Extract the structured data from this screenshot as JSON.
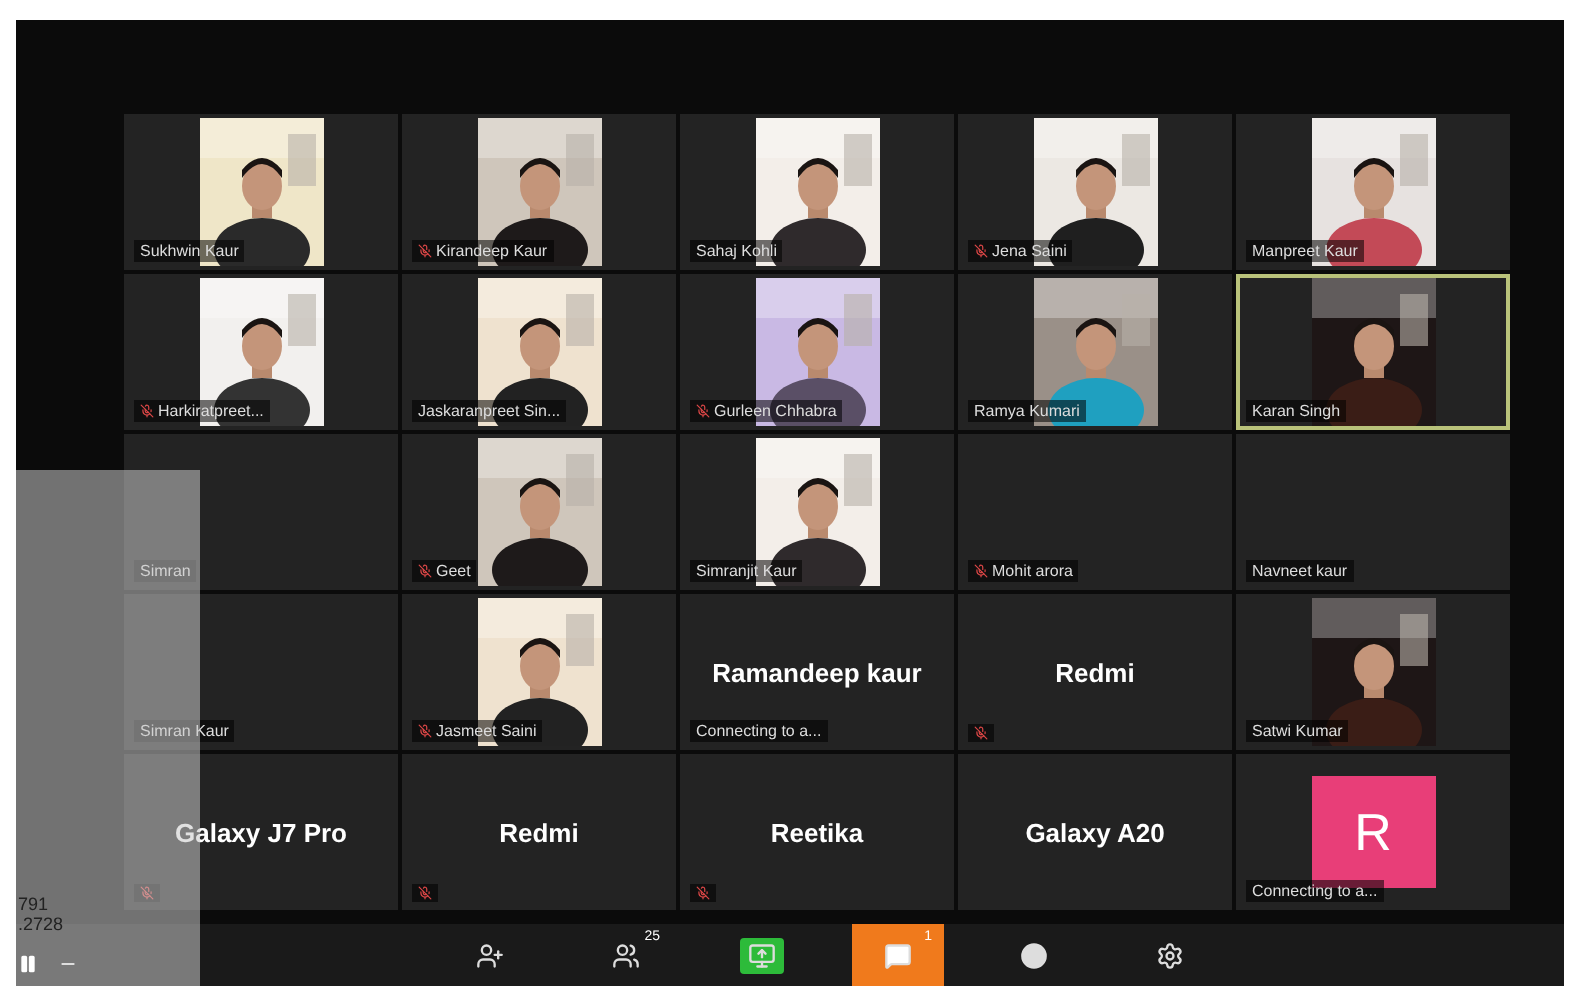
{
  "tiles": [
    {
      "kind": "video",
      "name": "Sukhwin Kaur",
      "muted": false,
      "selected": false
    },
    {
      "kind": "video",
      "name": "Kirandeep Kaur",
      "muted": true,
      "selected": false
    },
    {
      "kind": "video",
      "name": "Sahaj Kohli",
      "muted": false,
      "selected": false
    },
    {
      "kind": "video",
      "name": "Jena Saini",
      "muted": true,
      "selected": false
    },
    {
      "kind": "video",
      "name": "Manpreet Kaur",
      "muted": false,
      "selected": false
    },
    {
      "kind": "video",
      "name": "Harkiratpreet...",
      "muted": true,
      "selected": false
    },
    {
      "kind": "video",
      "name": "Jaskaranpreet Sin...",
      "muted": false,
      "selected": false
    },
    {
      "kind": "video",
      "name": "Gurleen Chhabra",
      "muted": true,
      "selected": false
    },
    {
      "kind": "video",
      "name": "Ramya Kumari",
      "muted": false,
      "selected": false
    },
    {
      "kind": "video",
      "name": "Karan Singh",
      "muted": false,
      "selected": true
    },
    {
      "kind": "empty",
      "name": "Simran",
      "muted": false,
      "selected": false
    },
    {
      "kind": "video",
      "name": "Geet",
      "muted": true,
      "selected": false
    },
    {
      "kind": "video",
      "name": "Simranjit Kaur",
      "muted": false,
      "selected": false
    },
    {
      "kind": "empty",
      "name": "Mohit arora",
      "muted": true,
      "selected": false
    },
    {
      "kind": "empty",
      "name": "Navneet kaur",
      "muted": false,
      "selected": false
    },
    {
      "kind": "empty",
      "name": "Simran Kaur",
      "muted": false,
      "selected": false
    },
    {
      "kind": "video",
      "name": "Jasmeet Saini",
      "muted": true,
      "selected": false
    },
    {
      "kind": "label",
      "name": "Ramandeep kaur",
      "status": "Connecting to a...",
      "muted": false,
      "selected": false
    },
    {
      "kind": "label",
      "name": "Redmi",
      "muted": true,
      "selected": false
    },
    {
      "kind": "video",
      "name": "Satwi Kumar",
      "muted": false,
      "selected": false
    },
    {
      "kind": "label",
      "name": "Galaxy J7 Pro",
      "muted": true,
      "selected": false
    },
    {
      "kind": "label",
      "name": "Redmi",
      "muted": true,
      "selected": false
    },
    {
      "kind": "label",
      "name": "Reetika",
      "muted": true,
      "selected": false
    },
    {
      "kind": "label",
      "name": "Galaxy A20",
      "muted": false,
      "selected": false
    },
    {
      "kind": "avatar",
      "initial": "R",
      "status": "Connecting to a...",
      "muted": false,
      "selected": false
    }
  ],
  "overlay": {
    "lines": [
      "791",
      ".2728"
    ]
  },
  "toolbar": [
    {
      "kind": "invite",
      "active": false
    },
    {
      "kind": "participants",
      "badge": "25",
      "active": false
    },
    {
      "kind": "share",
      "active": true
    },
    {
      "kind": "chat",
      "badge": "1",
      "active": true
    },
    {
      "kind": "record",
      "active": false
    },
    {
      "kind": "settings",
      "active": false
    }
  ]
}
